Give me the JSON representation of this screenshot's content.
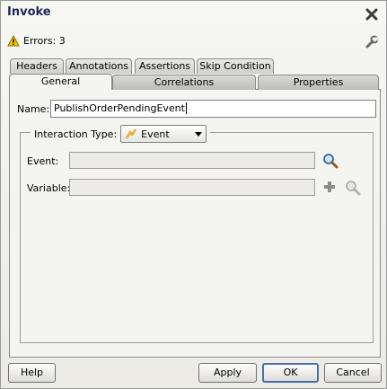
{
  "dialog": {
    "title": "Invoke",
    "errors_text": "Errors: 3"
  },
  "tabs_row1": [
    {
      "label": "Headers"
    },
    {
      "label": "Annotations"
    },
    {
      "label": "Assertions"
    },
    {
      "label": "Skip Condition"
    }
  ],
  "tabs_row2": [
    {
      "label": "General",
      "active": true
    },
    {
      "label": "Correlations"
    },
    {
      "label": "Properties"
    }
  ],
  "general": {
    "name_label": "Name:",
    "name_value": "PublishOrderPendingEvent",
    "interaction_type_label": "Interaction Type:",
    "interaction_type_value": "Event",
    "event_label": "Event:",
    "event_value": "",
    "variable_label": "Variable:",
    "variable_value": ""
  },
  "buttons": {
    "help": "Help",
    "apply": "Apply",
    "ok": "OK",
    "cancel": "Cancel"
  },
  "icons": {
    "warning": "warning-icon",
    "close": "close-icon",
    "wrench": "wrench-icon",
    "event_type": "lightning-icon",
    "search": "search-icon",
    "add": "plus-icon"
  }
}
